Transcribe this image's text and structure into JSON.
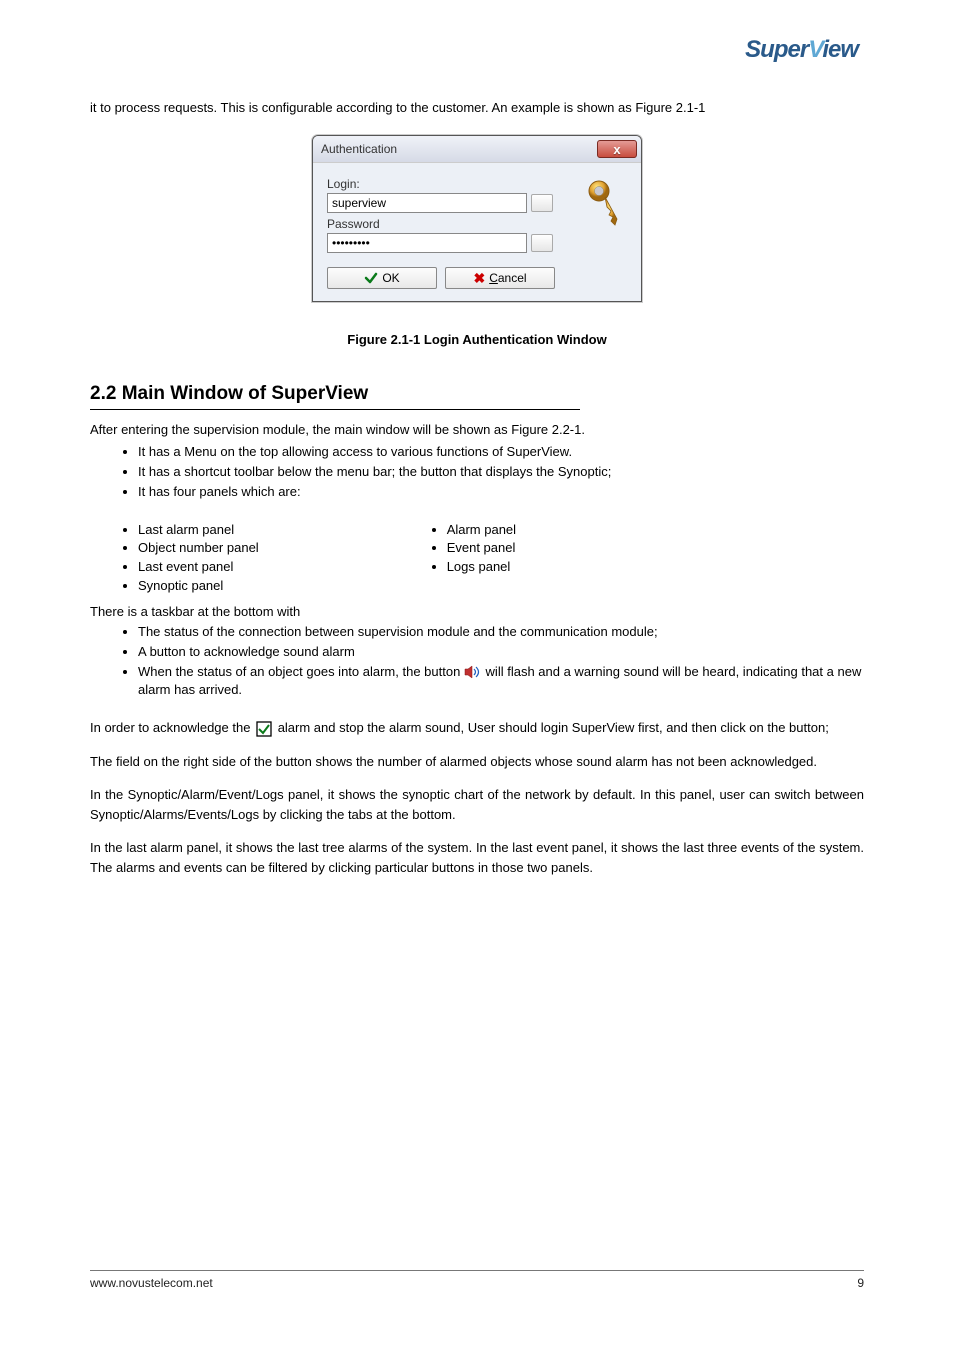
{
  "header": {
    "logo_pre": "Super",
    "logo_v": "V",
    "logo_post": "iew"
  },
  "intro": "it to process requests. This is configurable according to the customer. An example is shown as Figure 2.1-1",
  "dialog": {
    "title": "Authentication",
    "close": "x",
    "login_label": "Login:",
    "login_value": "superview",
    "password_label": "Password",
    "password_value": "xxxxxxxxx",
    "ok_label": "OK",
    "cancel_prefix": "C",
    "cancel_rest": "ancel"
  },
  "figure_caption": "Figure 2.1-1 Login Authentication Window",
  "section2": {
    "heading": "2.2 Main Window of SuperView",
    "intro": "After entering the supervision module, the main window will be shown as Figure 2.2-1.",
    "list1": [
      "It has a Menu on the top allowing access to various functions of SuperView.",
      "It has a shortcut toolbar below the menu bar; the button that displays the Synoptic;",
      "It has four panels which are:"
    ],
    "panels_left": [
      "Last alarm panel",
      "Object number panel",
      "Last event panel",
      "Synoptic panel"
    ],
    "panels_right": [
      "Alarm panel",
      "Event panel",
      "Logs panel"
    ],
    "intro2": "There is a taskbar at the bottom with",
    "list2_item1": "The status of the connection between supervision module and the communication module;",
    "list2_item2": "A button to acknowledge sound alarm",
    "list2_item3_pre": "When the status of an object goes into alarm, the button ",
    "list2_item3_post": " will flash and a warning sound will be heard, indicating that a new alarm has arrived."
  },
  "paras": {
    "p1_pre": "In order to acknowledge the ",
    "p1_post": " alarm and stop the alarm sound, User should login SuperView first, and then click on the button;",
    "p2": "The field on the right side of the button shows the number of alarmed objects whose sound alarm has not been acknowledged.",
    "p3": "In the Synoptic/Alarm/Event/Logs panel, it shows the synoptic chart of the network by default. In this panel, user can switch between Synoptic/Alarms/Events/Logs by clicking the tabs at the bottom.",
    "p4": "In the last alarm panel, it shows the last tree alarms of the system. In the last event panel, it shows the last three events of the system. The alarms and events can be filtered by clicking particular buttons in those two panels."
  },
  "footer": {
    "left": "www.novustelecom.net",
    "right": "9"
  }
}
